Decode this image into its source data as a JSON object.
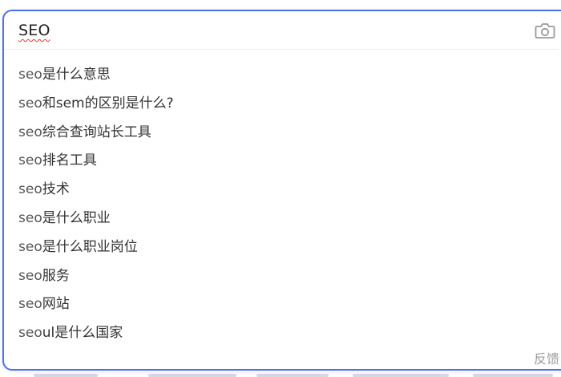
{
  "search": {
    "query": "SEO"
  },
  "suggestions": [
    {
      "prefix": "seo",
      "rest": "是什么意思"
    },
    {
      "prefix": "seo",
      "rest": "和sem的区别是什么?"
    },
    {
      "prefix": "seo",
      "rest": "综合查询站长工具"
    },
    {
      "prefix": "seo",
      "rest": "排名工具"
    },
    {
      "prefix": "seo",
      "rest": "技术"
    },
    {
      "prefix": "seo",
      "rest": "是什么职业"
    },
    {
      "prefix": "seo",
      "rest": "是什么职业岗位"
    },
    {
      "prefix": "seo",
      "rest": "服务"
    },
    {
      "prefix": "seo",
      "rest": "网站"
    },
    {
      "prefix": "seo",
      "rest": "ul是什么国家"
    }
  ],
  "feedback_label": "反馈",
  "icons": {
    "camera": "camera-icon"
  },
  "colors": {
    "border_accent": "#4e6ef2",
    "spellcheck_underline": "#e53935",
    "feedback_text": "#9c9c9c"
  }
}
